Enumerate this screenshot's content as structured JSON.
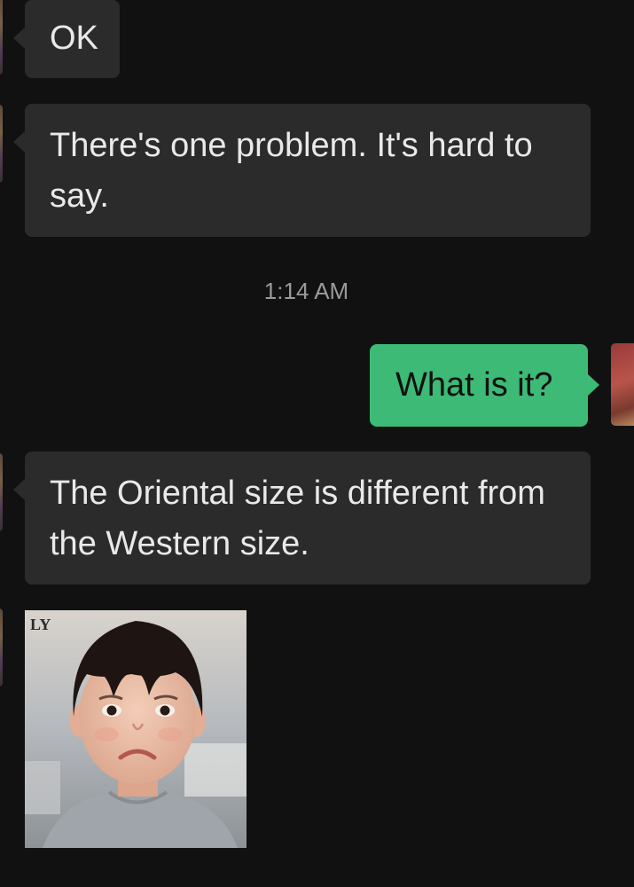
{
  "messages": [
    {
      "id": "m1",
      "side": "incoming",
      "text": "OK"
    },
    {
      "id": "m2",
      "side": "incoming",
      "text": "There's one problem. It's hard to say."
    },
    {
      "id": "m3",
      "side": "outgoing",
      "text": "What is it?"
    },
    {
      "id": "m4",
      "side": "incoming",
      "text": "The Oriental size is different from the Western size."
    },
    {
      "id": "m5",
      "side": "incoming",
      "type": "image",
      "image_description": "crying-child-sticker",
      "watermark_text": "LY"
    }
  ],
  "timestamp": "1:14 AM",
  "colors": {
    "background": "#111111",
    "incoming_bubble": "#2b2b2b",
    "outgoing_bubble": "#3dba75",
    "incoming_text": "#e9e9e9",
    "outgoing_text": "#111111",
    "timestamp_text": "#9a9a9a"
  }
}
